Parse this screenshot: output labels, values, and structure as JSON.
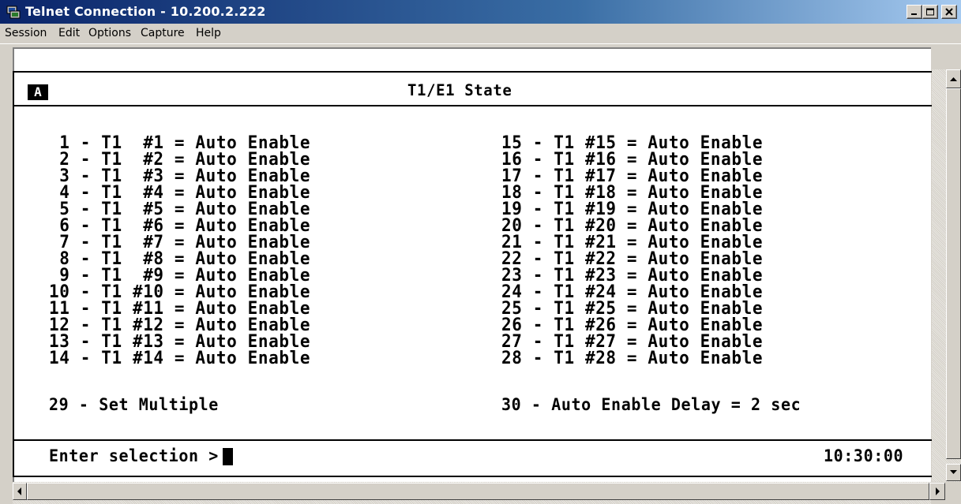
{
  "window": {
    "title": "Telnet Connection - 10.200.2.222",
    "controls": [
      "minimize",
      "maximize",
      "close"
    ]
  },
  "menu": [
    "Session",
    "Edit",
    "Options",
    "Capture",
    "Help"
  ],
  "terminal": {
    "badge": "A",
    "header_title": "T1/E1 State",
    "left_column": [
      " 1 - T1  #1 = Auto Enable",
      " 2 - T1  #2 = Auto Enable",
      " 3 - T1  #3 = Auto Enable",
      " 4 - T1  #4 = Auto Enable",
      " 5 - T1  #5 = Auto Enable",
      " 6 - T1  #6 = Auto Enable",
      " 7 - T1  #7 = Auto Enable",
      " 8 - T1  #8 = Auto Enable",
      " 9 - T1  #9 = Auto Enable",
      "10 - T1 #10 = Auto Enable",
      "11 - T1 #11 = Auto Enable",
      "12 - T1 #12 = Auto Enable",
      "13 - T1 #13 = Auto Enable",
      "14 - T1 #14 = Auto Enable"
    ],
    "right_column": [
      "15 - T1 #15 = Auto Enable",
      "16 - T1 #16 = Auto Enable",
      "17 - T1 #17 = Auto Enable",
      "18 - T1 #18 = Auto Enable",
      "19 - T1 #19 = Auto Enable",
      "20 - T1 #20 = Auto Enable",
      "21 - T1 #21 = Auto Enable",
      "22 - T1 #22 = Auto Enable",
      "23 - T1 #23 = Auto Enable",
      "24 - T1 #24 = Auto Enable",
      "25 - T1 #25 = Auto Enable",
      "26 - T1 #26 = Auto Enable",
      "27 - T1 #27 = Auto Enable",
      "28 - T1 #28 = Auto Enable"
    ],
    "option_29": "29 - Set Multiple",
    "option_30": "30 - Auto Enable Delay = 2 sec",
    "prompt": "Enter selection >",
    "clock": "10:30:00"
  },
  "colors": {
    "titlebar_start": "#0a246a",
    "titlebar_end": "#a6caf0",
    "chrome": "#d4d0c8",
    "terminal_bg": "#ffffff",
    "terminal_fg": "#000000"
  }
}
